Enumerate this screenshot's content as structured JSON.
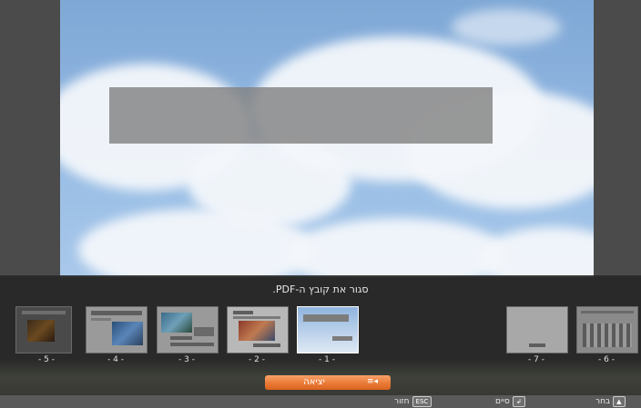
{
  "overlay": {
    "hint": "סגור את קובץ ה-PDF."
  },
  "thumbnails": [
    {
      "label": "- 5 -"
    },
    {
      "label": "- 4 -"
    },
    {
      "label": "- 3 -"
    },
    {
      "label": "- 2 -"
    },
    {
      "label": "- 1 -"
    },
    {
      "label": "- 7 -"
    },
    {
      "label": "- 6 -"
    }
  ],
  "exit_button": {
    "label": "יציאה",
    "icon": "exit-menu-icon"
  },
  "bottom_bar": {
    "back_label": "חזור",
    "back_key": "ESC",
    "finish_label": "סיים",
    "finish_key": "↲",
    "select_label": "בחר",
    "select_key": "▲"
  },
  "colors": {
    "accent": "#ea7a36",
    "overlay": "#282828"
  }
}
